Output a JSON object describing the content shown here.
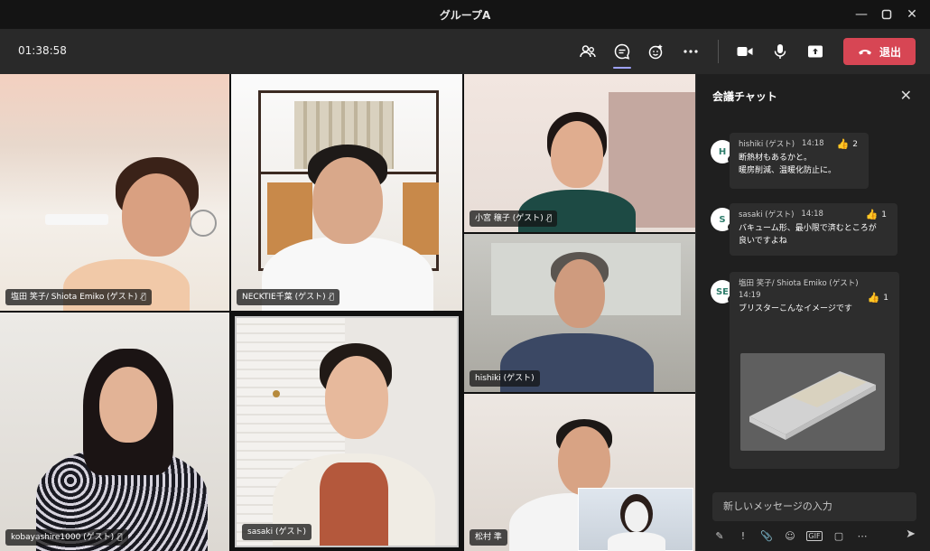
{
  "window": {
    "title": "グループA"
  },
  "toolbar": {
    "timer": "01:38:58",
    "leave_label": "退出",
    "icons": [
      "people-icon",
      "chat-icon",
      "reactions-icon",
      "more-icon",
      "camera-icon",
      "mic-icon",
      "share-icon"
    ]
  },
  "participants": [
    {
      "name": "塩田 笑子/ Shiota Emiko (ゲスト)"
    },
    {
      "name": "NECKTIE千葉 (ゲスト)"
    },
    {
      "name": "小宮 穣子 (ゲスト)"
    },
    {
      "name": "hishiki (ゲスト)"
    },
    {
      "name": "kobayashire1000 (ゲスト)"
    },
    {
      "name": "sasaki (ゲスト)"
    },
    {
      "name": "松村 準"
    }
  ],
  "chat": {
    "title": "会議チャット",
    "messages": [
      {
        "avatar": "H",
        "author": "hishiki (ゲスト)",
        "time": "14:18",
        "likes": "2",
        "line1": "断熱材もあるかと。",
        "line2": "暖房削減、温暖化防止に。"
      },
      {
        "avatar": "S",
        "author": "sasaki (ゲスト)",
        "time": "14:18",
        "likes": "1",
        "line1": "バキューム形、最小限で済むところが",
        "line2": "良いですよね"
      },
      {
        "avatar": "SE",
        "author": "塩田 笑子/ Shiota Emiko (ゲスト)",
        "time": "14:19",
        "likes": "1",
        "line1": "ブリスターこんなイメージです",
        "line2": ""
      }
    ],
    "compose_placeholder": "新しいメッセージの入力"
  },
  "colors": {
    "leave": "#d74654",
    "accent": "#9ea2ff",
    "panel": "#1f1f1f"
  }
}
